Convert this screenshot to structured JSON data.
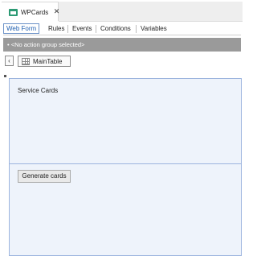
{
  "document_tab": {
    "title": "WPCards",
    "close_glyph": "✕"
  },
  "subtabs": [
    {
      "label": "Web Form",
      "active": true
    },
    {
      "label": "Rules"
    },
    {
      "label": "Events"
    },
    {
      "label": "Conditions"
    },
    {
      "label": "Variables"
    }
  ],
  "action_bar": {
    "text": "• <No action group selected>"
  },
  "toolbar": {
    "back_glyph": "‹",
    "table_label": "MainTable"
  },
  "form": {
    "section_label": "Service Cards",
    "generate_button": "Generate cards"
  },
  "colors": {
    "accent": "#1f5fb0",
    "action_bar": "#9a9a9a",
    "table_fill": "#eef3fb",
    "table_border": "#9cb4de",
    "doc_icon": "#2c9a74"
  }
}
